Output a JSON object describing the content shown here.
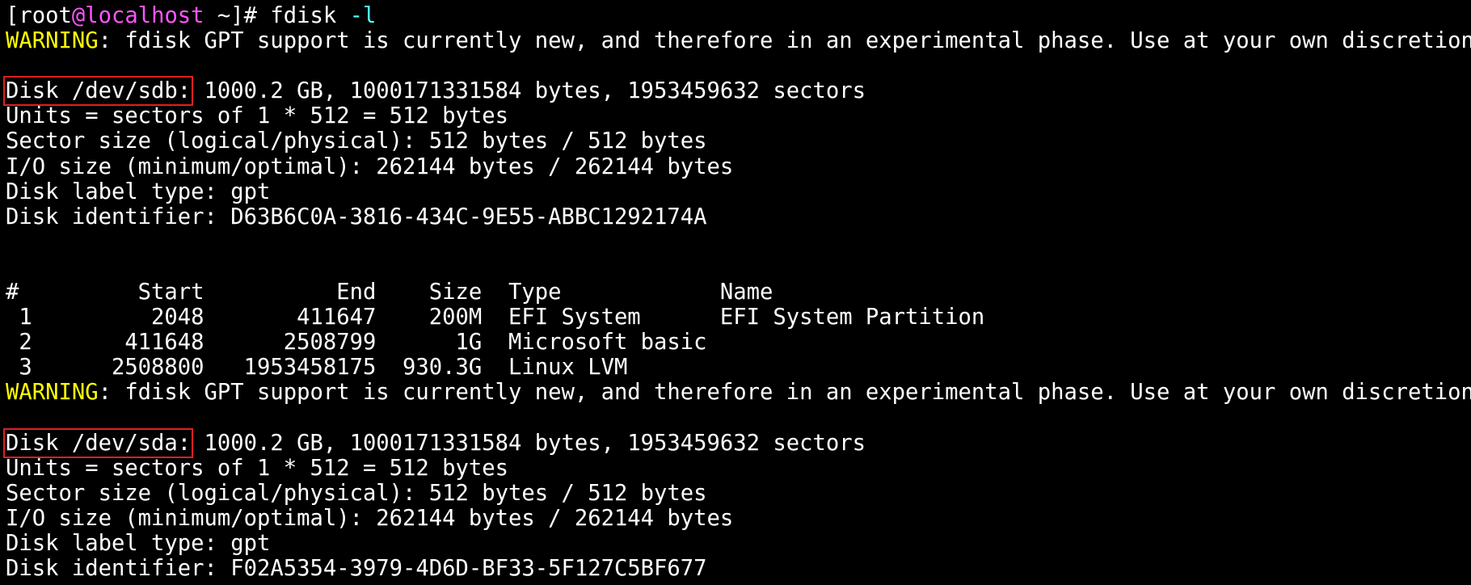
{
  "prompt": {
    "open_bracket": "[",
    "user": "root",
    "at": "@",
    "host": "localhost",
    "path_and_suffix": " ~]# ",
    "command": "fdisk",
    "space": " ",
    "flag": "-l"
  },
  "warning": {
    "label": "WARNING",
    "text": ": fdisk GPT support is currently new, and therefore in an experimental phase. Use at your own discretion."
  },
  "disks": [
    {
      "header_label": "Disk /dev/sdb:",
      "header_rest": " 1000.2 GB, 1000171331584 bytes, 1953459632 sectors",
      "units": "Units = sectors of 1 * 512 = 512 bytes",
      "sector_size": "Sector size (logical/physical): 512 bytes / 512 bytes",
      "io_size": "I/O size (minimum/optimal): 262144 bytes / 262144 bytes",
      "label_type": "Disk label type: gpt",
      "identifier": "Disk identifier: D63B6C0A-3816-434C-9E55-ABBC1292174A"
    },
    {
      "header_label": "Disk /dev/sda:",
      "header_rest": " 1000.2 GB, 1000171331584 bytes, 1953459632 sectors",
      "units": "Units = sectors of 1 * 512 = 512 bytes",
      "sector_size": "Sector size (logical/physical): 512 bytes / 512 bytes",
      "io_size": "I/O size (minimum/optimal): 262144 bytes / 262144 bytes",
      "label_type": "Disk label type: gpt",
      "identifier": "Disk identifier: F02A5354-3979-4D6D-BF33-5F127C5BF677"
    }
  ],
  "partition_table": {
    "header": "#         Start          End    Size  Type            Name",
    "rows": [
      " 1         2048       411647    200M  EFI System      EFI System Partition",
      " 2       411648      2508799      1G  Microsoft basic ",
      " 3      2508800   1953458175  930.3G  Linux LVM       "
    ]
  },
  "colors": {
    "background": "#000000",
    "text": "#ffffff",
    "warning": "#ffff00",
    "hostname": "#ff55ff",
    "flag": "#55ffff",
    "highlight_box": "#e02020"
  }
}
